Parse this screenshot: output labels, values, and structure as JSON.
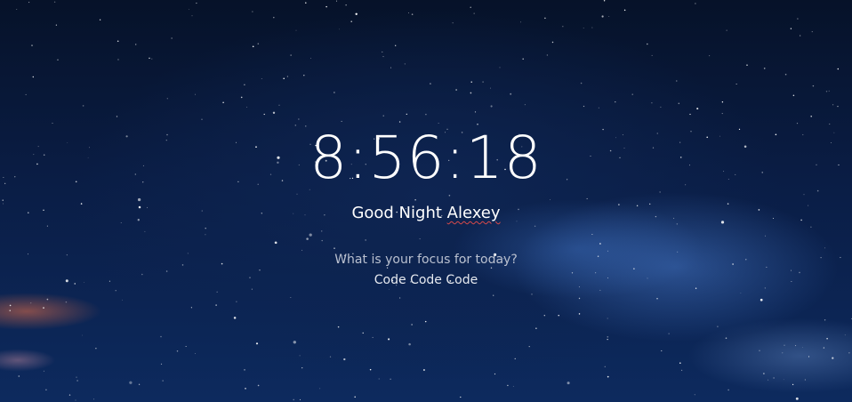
{
  "clock": {
    "time": "8:56:18"
  },
  "greeting": {
    "prefix": "Good Night ",
    "name": "Alexey"
  },
  "focus": {
    "question": "What is your focus for today?",
    "answer": "Code Code Code"
  },
  "colors": {
    "text_primary": "#ffffff",
    "text_muted": "#b9c0cf",
    "sky_dark": "#061229",
    "sky_mid": "#0d2a5e"
  }
}
